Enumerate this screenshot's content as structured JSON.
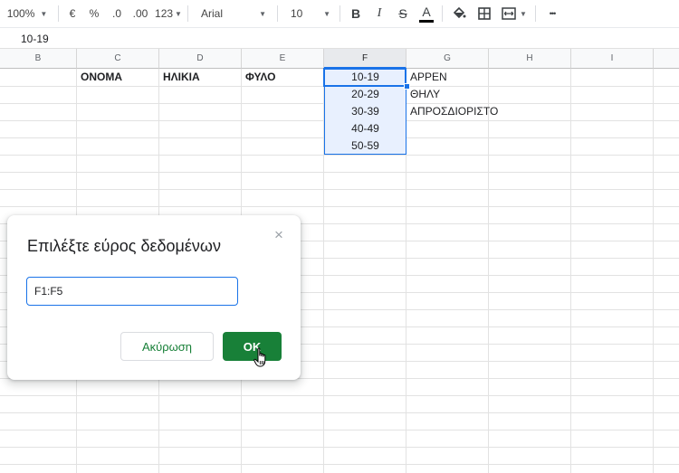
{
  "toolbar": {
    "zoom": "100%",
    "currency": "€",
    "percent": "%",
    "decrease_decimals": ".0",
    "increase_decimals": ".00",
    "more_formats": "123",
    "font": "Arial",
    "font_size": "10",
    "bold": "B",
    "italic": "I",
    "strikethrough": "S",
    "text_color": "A",
    "more": "•••"
  },
  "formula_bar": {
    "value": "10-19"
  },
  "columns": [
    "B",
    "C",
    "D",
    "E",
    "F",
    "G",
    "H",
    "I"
  ],
  "selected_column": "F",
  "sheet": {
    "headers": {
      "name": "ΟΝΟΜΑ",
      "age": "ΗΛΙΚΙΑ",
      "gender": "ΦΥΛΟ"
    },
    "age_ranges": [
      "10-19",
      "20-29",
      "30-39",
      "40-49",
      "50-59"
    ],
    "genders": [
      "ΑΡΡΕΝ",
      "ΘΗΛΥ",
      "ΑΠΡΟΣΔΙΟΡΙΣΤΟ"
    ]
  },
  "dialog": {
    "title": "Επιλέξτε εύρος δεδομένων",
    "range_value": "F1:F5",
    "cancel_label": "Ακύρωση",
    "ok_label": "OK",
    "close": "×"
  }
}
